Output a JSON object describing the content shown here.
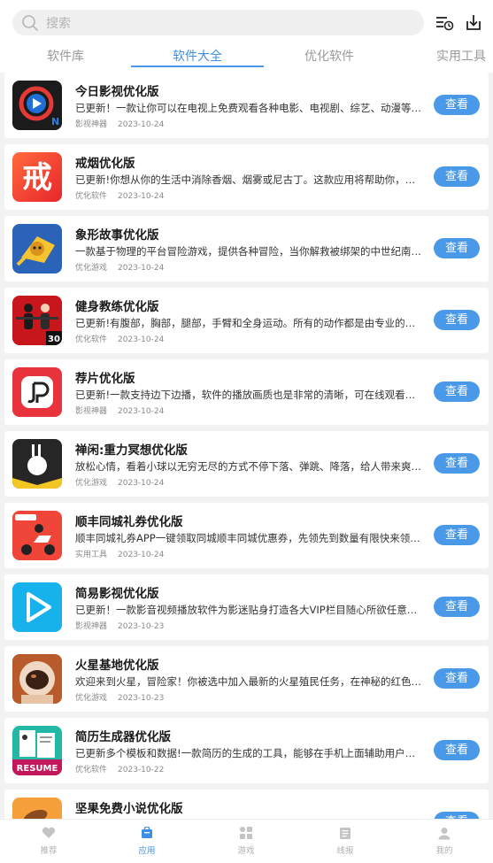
{
  "search": {
    "placeholder": "搜索",
    "icon": "search-icon"
  },
  "header_actions": [
    {
      "icon": "history-list-icon"
    },
    {
      "icon": "download-icon"
    }
  ],
  "tabs": [
    {
      "label": "软件库",
      "active": false
    },
    {
      "label": "软件大全",
      "active": true
    },
    {
      "label": "优化软件",
      "active": false
    },
    {
      "label": "实用工具",
      "active": false
    }
  ],
  "apps": [
    {
      "title": "今日影视优化版",
      "desc": "已更新！一款让你可以在电视上免费观看各种电影、电视剧、综艺、动漫等节目的软件",
      "category": "影视神器",
      "date": "2023-10-24",
      "button": "查看"
    },
    {
      "title": "戒烟优化版",
      "desc": "已更新!你想从你的生活中消除香烟、烟雾或尼古丁。这款应用将帮助你，记录你的戒烟进程",
      "category": "优化软件",
      "date": "2023-10-24",
      "button": "查看"
    },
    {
      "title": "象形故事优化版",
      "desc": "一款基于物理的平台冒险游戏，提供各种冒险，当你解救被绑架的中世纪南瓜王子时",
      "category": "优化游戏",
      "date": "2023-10-24",
      "button": "查看"
    },
    {
      "title": "健身教练优化版",
      "desc": "已更新!有腹部，胸部，腿部，手臂和全身运动。所有的动作都是由专业的健身教练设计",
      "category": "优化软件",
      "date": "2023-10-24",
      "button": "查看"
    },
    {
      "title": "荐片优化版",
      "desc": "已更新!一款支持边下边播，软件的播放画质也是非常的清晰，可在线观看丰富的影视资源",
      "category": "影视神器",
      "date": "2023-10-24",
      "button": "查看"
    },
    {
      "title": "禅闲:重力冥想优化版",
      "desc": "放松心情，看着小球以无穷无尽的方式不停下落、弹跳、降落，给人带来爽快的感觉",
      "category": "优化游戏",
      "date": "2023-10-24",
      "button": "查看"
    },
    {
      "title": "顺丰同城礼券优化版",
      "desc": "顺丰同城礼券APP一键领取同城顺丰同城优惠券，先领先到数量有限快来领取吧",
      "category": "实用工具",
      "date": "2023-10-24",
      "button": "查看"
    },
    {
      "title": "简易影视优化版",
      "desc": "已更新！一款影音视频播放软件为影迷贴身打造各大VIP栏目随心所欲任意观看的应用",
      "category": "影视神器",
      "date": "2023-10-23",
      "button": "查看"
    },
    {
      "title": "火星基地优化版",
      "desc": "欢迎来到火星，冒险家！你被选中加入最新的火星殖民任务，在神秘的红色星球上建立基地",
      "category": "优化游戏",
      "date": "2023-10-23",
      "button": "查看"
    },
    {
      "title": "简历生成器优化版",
      "desc": "已更新多个模板和数据!一款简历的生成的工具，能够在手机上面辅助用户来进行简历制作",
      "category": "优化软件",
      "date": "2023-10-22",
      "button": "查看"
    },
    {
      "title": "坚果免费小说优化版",
      "desc": "",
      "category": "",
      "date": "",
      "button": "查看"
    }
  ],
  "icon_text": {
    "resume": "RESUME",
    "fitness_badge": "30",
    "smoking": "戒"
  },
  "bottom_nav": [
    {
      "label": "推荐",
      "icon": "heart-icon",
      "active": false
    },
    {
      "label": "应用",
      "icon": "app-bag-icon",
      "active": true
    },
    {
      "label": "游戏",
      "icon": "grid-icon",
      "active": false
    },
    {
      "label": "线报",
      "icon": "news-icon",
      "active": false
    },
    {
      "label": "我的",
      "icon": "user-icon",
      "active": false
    }
  ],
  "colors": {
    "accent": "#4a98e8",
    "active_tab": "#3e8fe4",
    "background": "#f2f2f2"
  }
}
